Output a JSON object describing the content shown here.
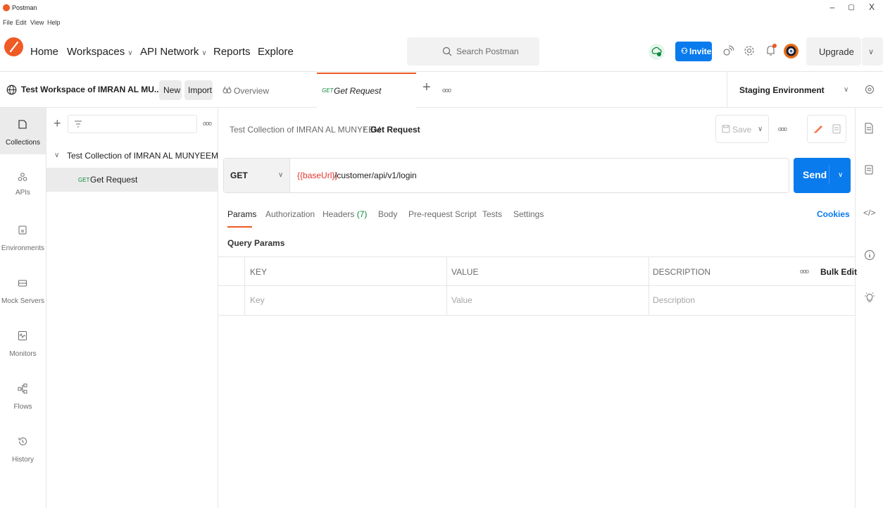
{
  "app": {
    "title": "Postman",
    "menu": [
      "File",
      "Edit",
      "View",
      "Help"
    ],
    "window_controls": [
      "–",
      "▢",
      "X"
    ]
  },
  "header": {
    "nav": [
      "Home",
      "Workspaces",
      "API Network",
      "Reports",
      "Explore"
    ],
    "search_placeholder": "Search Postman",
    "invite_label": "Invite",
    "upgrade_label": "Upgrade"
  },
  "workspace": {
    "name": "Test Workspace of IMRAN AL MU...",
    "new_label": "New",
    "import_label": "Import"
  },
  "rail": {
    "items": [
      "Collections",
      "APIs",
      "Environments",
      "Mock Servers",
      "Monitors",
      "Flows",
      "History"
    ]
  },
  "sidebar": {
    "collection_name": "Test Collection of IMRAN AL MUNYEEM",
    "request": {
      "method": "GET",
      "name": "Get Request"
    }
  },
  "tabs": {
    "overview_label": "Overview",
    "active": {
      "method": "GET",
      "name": "Get Request"
    },
    "environment": "Staging Environment"
  },
  "request": {
    "breadcrumb_collection": "Test Collection of IMRAN AL MUNYEEM",
    "breadcrumb_separator": "/",
    "breadcrumb_request": "Get Request",
    "save_label": "Save",
    "method": "GET",
    "url_variable": "{{baseUrl}}",
    "url_path": "/customer/api/v1/login",
    "send_label": "Send",
    "tabs": [
      "Params",
      "Authorization",
      "Headers",
      "Body",
      "Pre-request Script",
      "Tests",
      "Settings"
    ],
    "headers_count": "(7)",
    "cookies_label": "Cookies",
    "query_params_title": "Query Params"
  },
  "params_table": {
    "columns": [
      "KEY",
      "VALUE",
      "DESCRIPTION"
    ],
    "bulk_edit_label": "Bulk Edit",
    "placeholders": [
      "Key",
      "Value",
      "Description"
    ]
  },
  "colors": {
    "accent": "#ef5b25",
    "primary": "#097bed",
    "url_variable": "#e0342b",
    "get_method": "#0b8a3a"
  }
}
